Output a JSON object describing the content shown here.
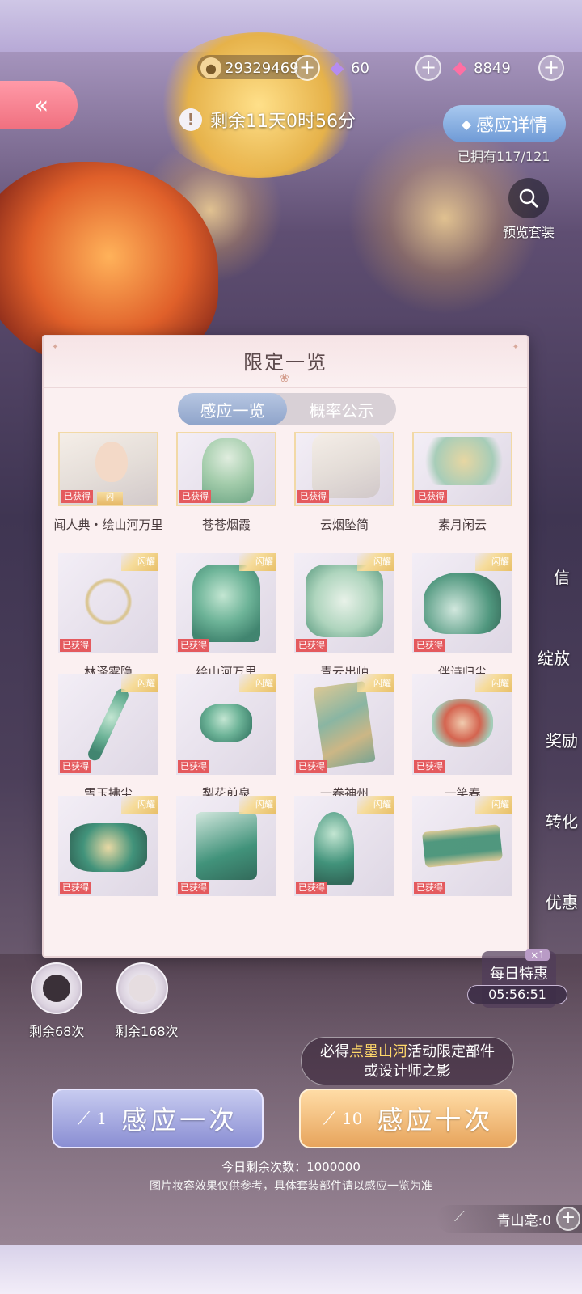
{
  "currency": {
    "coins": "29329469",
    "diamonds": "60",
    "gems": "8849",
    "coin_icon": "cat-coin-icon",
    "diamond_icon": "purple-diamond-icon",
    "gem_icon": "pink-gem-icon"
  },
  "back_button_icon": "double-chevron-left-icon",
  "timer": {
    "icon": "!",
    "text": "剩余11天0时56分"
  },
  "detail_button": {
    "label": "感应详情"
  },
  "owned_text": "已拥有117/121",
  "preview": {
    "label": "预览套装",
    "icon": "magnifier-icon"
  },
  "side_labels": [
    "信",
    "绽放",
    "奖励",
    "转化",
    "优惠"
  ],
  "modal": {
    "title": "限定一览",
    "tabs": [
      {
        "label": "感应一览",
        "active": true
      },
      {
        "label": "概率公示",
        "active": false
      }
    ],
    "obtained_label": "已获得",
    "corner_badge": "闪耀",
    "first_badge": "闪",
    "items": [
      {
        "name": "闻人典・绘山河万里"
      },
      {
        "name": "苍苍烟霞"
      },
      {
        "name": "云烟坠简"
      },
      {
        "name": "素月闲云"
      },
      {
        "name": "林泽雾隐"
      },
      {
        "name": "绘山河万里"
      },
      {
        "name": "青云出岫"
      },
      {
        "name": "伴诗归尘"
      },
      {
        "name": "雪玉拂尘"
      },
      {
        "name": "梨花煎泉"
      },
      {
        "name": "一卷神州"
      },
      {
        "name": "一笑春"
      },
      {
        "name": ""
      },
      {
        "name": ""
      },
      {
        "name": ""
      },
      {
        "name": ""
      }
    ]
  },
  "chances": [
    {
      "text": "剩余68次"
    },
    {
      "text": "剩余168次"
    }
  ],
  "daily": {
    "title": "每日特惠",
    "count": "×1",
    "time": "05:56:51"
  },
  "guarantee": {
    "prefix": "必得",
    "highlight": "点墨山河",
    "suffix": "活动限定部件",
    "line2": "或设计师之影"
  },
  "draw_one": {
    "num": "1",
    "label": "感应一次"
  },
  "draw_ten": {
    "num": "10",
    "label": "感应十次"
  },
  "remain_today": "今日剩余次数：1000000",
  "disclaimer": "图片妆容效果仅供参考，具体套装部件请以感应一览为准",
  "token": {
    "label": "青山毫:0"
  }
}
